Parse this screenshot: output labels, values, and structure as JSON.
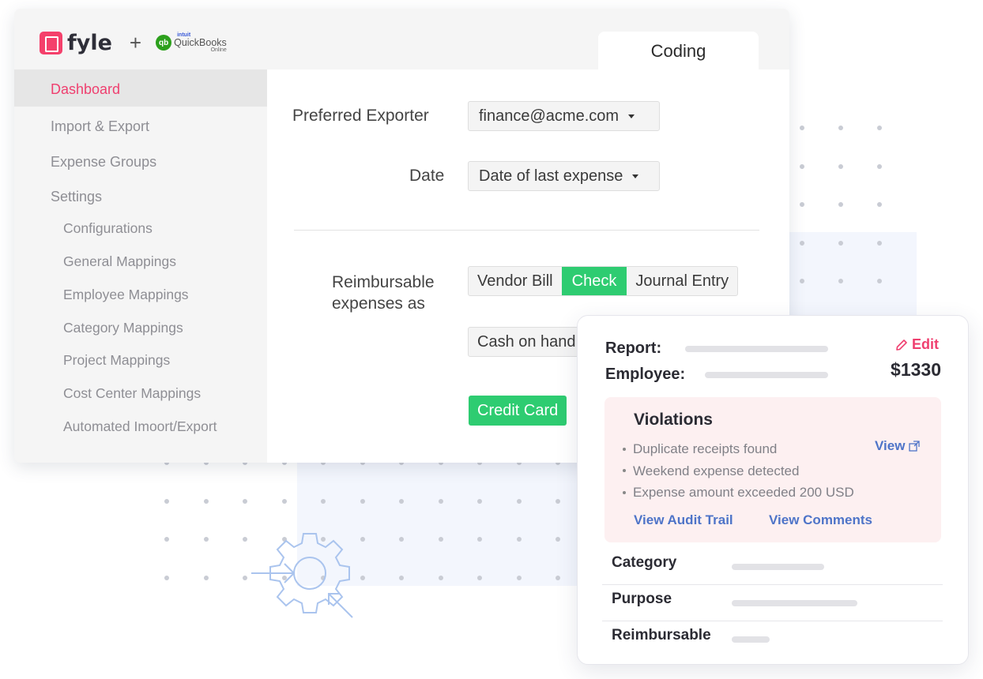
{
  "brand": {
    "name": "fyle",
    "plus": "+",
    "partner_intuit": "intuit",
    "partner_name": "QuickBooks",
    "partner_online": "Online",
    "partner_badge": "qb"
  },
  "tab": {
    "label": "Coding"
  },
  "sidebar": {
    "items": [
      {
        "label": "Dashboard",
        "active": true
      },
      {
        "label": "Import & Export"
      },
      {
        "label": "Expense Groups"
      },
      {
        "label": "Settings"
      }
    ],
    "settings_items": [
      {
        "label": "Configurations"
      },
      {
        "label": "General Mappings"
      },
      {
        "label": "Employee Mappings"
      },
      {
        "label": "Category Mappings"
      },
      {
        "label": "Project Mappings"
      },
      {
        "label": "Cost Center Mappings"
      },
      {
        "label": "Automated Imoort/Export"
      }
    ]
  },
  "form": {
    "preferred_exporter_label": "Preferred Exporter",
    "preferred_exporter_value": "finance@acme.com",
    "date_label": "Date",
    "date_value": "Date of last expense",
    "reimbursable_label_line1": "Reimbursable",
    "reimbursable_label_line2": "expenses as",
    "reimbursable_options": [
      {
        "label": "Vendor Bill",
        "selected": false
      },
      {
        "label": "Check",
        "selected": true
      },
      {
        "label": "Journal Entry",
        "selected": false
      }
    ],
    "account_value": "Cash on hand",
    "ccc_option": "Credit Card"
  },
  "card": {
    "report_label": "Report:",
    "employee_label": "Employee:",
    "edit_label": "Edit",
    "amount": "$1330",
    "violations_title": "Violations",
    "violations": [
      "Duplicate receipts found",
      "Weekend expense detected",
      "Expense amount exceeded 200 USD"
    ],
    "view_label": "View",
    "audit_trail_label": "View Audit Trail",
    "comments_label": "View Comments",
    "details": [
      {
        "label": "Category"
      },
      {
        "label": "Purpose"
      },
      {
        "label": "Reimbursable"
      }
    ]
  },
  "colors": {
    "brand_pink": "#ef3f6f",
    "success_green": "#2ecc71",
    "link_blue": "#4e74c8",
    "violation_bg": "#fdf0f1",
    "quickbooks_green": "#2ca01c"
  }
}
